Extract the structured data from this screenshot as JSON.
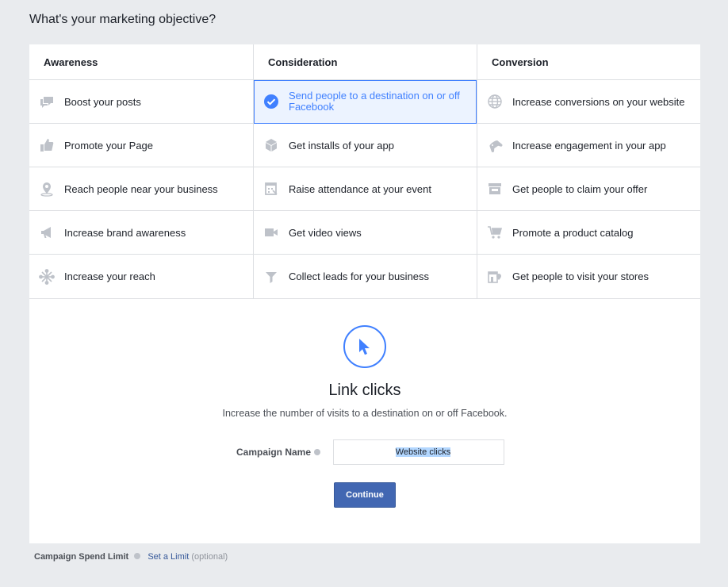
{
  "title": "What's your marketing objective?",
  "columns": [
    {
      "heading": "Awareness",
      "items": [
        {
          "label": "Boost your posts",
          "icon": "chat-bubbles-icon"
        },
        {
          "label": "Promote your Page",
          "icon": "thumbs-up-icon"
        },
        {
          "label": "Reach people near your business",
          "icon": "map-pin-icon"
        },
        {
          "label": "Increase brand awareness",
          "icon": "megaphone-icon"
        },
        {
          "label": "Increase your reach",
          "icon": "burst-icon"
        }
      ]
    },
    {
      "heading": "Consideration",
      "items": [
        {
          "label": "Send people to a destination on or off Facebook",
          "icon": "checkmark-circle-icon",
          "selected": true
        },
        {
          "label": "Get installs of your app",
          "icon": "box-icon"
        },
        {
          "label": "Raise attendance at your event",
          "icon": "calendar-icon"
        },
        {
          "label": "Get video views",
          "icon": "video-camera-icon"
        },
        {
          "label": "Collect leads for your business",
          "icon": "funnel-icon"
        }
      ]
    },
    {
      "heading": "Conversion",
      "items": [
        {
          "label": "Increase conversions on your website",
          "icon": "globe-icon"
        },
        {
          "label": "Increase engagement in your app",
          "icon": "gamepad-icon"
        },
        {
          "label": "Get people to claim your offer",
          "icon": "storefront-icon"
        },
        {
          "label": "Promote a product catalog",
          "icon": "shopping-cart-icon"
        },
        {
          "label": "Get people to visit your stores",
          "icon": "store-building-icon"
        }
      ]
    }
  ],
  "detail": {
    "title": "Link clicks",
    "description": "Increase the number of visits to a destination on or off Facebook.",
    "icon": "cursor-icon"
  },
  "campaign": {
    "label": "Campaign Name",
    "value": "Website clicks"
  },
  "continue_label": "Continue",
  "footer": {
    "spend_label": "Campaign Spend Limit",
    "link_label": "Set a Limit",
    "optional_label": "(optional)"
  },
  "colors": {
    "accent": "#4080ff",
    "button": "#4267b2",
    "icon_gray": "#bec2c9"
  }
}
